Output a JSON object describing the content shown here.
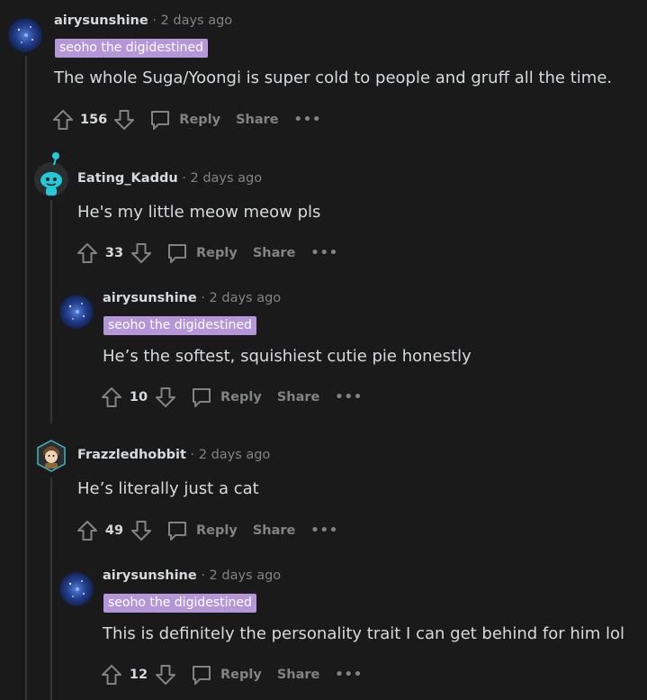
{
  "colors": {
    "background": "#1a1a1b",
    "text": "#d7dadc",
    "muted": "#818384",
    "flair_bg": "#b597d9",
    "thread_line": "#343536"
  },
  "comments": [
    {
      "author": "airysunshine",
      "dot": "·",
      "time": "2 days ago",
      "flair": "seoho the digidestined",
      "body": "The whole Suga/Yoongi is super cold to people and gruff all the time.",
      "score": "156",
      "reply_label": "Reply",
      "share_label": "Share",
      "more_label": "•••",
      "avatar_icon": "galaxy-avatar-icon"
    },
    {
      "author": "Eating_Kaddu",
      "dot": "·",
      "time": "2 days ago",
      "body": "He's my little meow meow pls",
      "score": "33",
      "reply_label": "Reply",
      "share_label": "Share",
      "more_label": "•••",
      "avatar_icon": "snoo-avatar-icon"
    },
    {
      "author": "airysunshine",
      "dot": "·",
      "time": "2 days ago",
      "flair": "seoho the digidestined",
      "body": "He’s the softest, squishiest cutie pie honestly",
      "score": "10",
      "reply_label": "Reply",
      "share_label": "Share",
      "more_label": "•••",
      "avatar_icon": "galaxy-avatar-icon"
    },
    {
      "author": "Frazzledhobbit",
      "dot": "·",
      "time": "2 days ago",
      "body": "He’s literally just a cat",
      "score": "49",
      "reply_label": "Reply",
      "share_label": "Share",
      "more_label": "•••",
      "avatar_icon": "hobbit-avatar-icon"
    },
    {
      "author": "airysunshine",
      "dot": "·",
      "time": "2 days ago",
      "flair": "seoho the digidestined",
      "body": "This is definitely the personality trait I can get behind for him lol",
      "score": "12",
      "reply_label": "Reply",
      "share_label": "Share",
      "more_label": "•••",
      "avatar_icon": "galaxy-avatar-icon"
    }
  ]
}
